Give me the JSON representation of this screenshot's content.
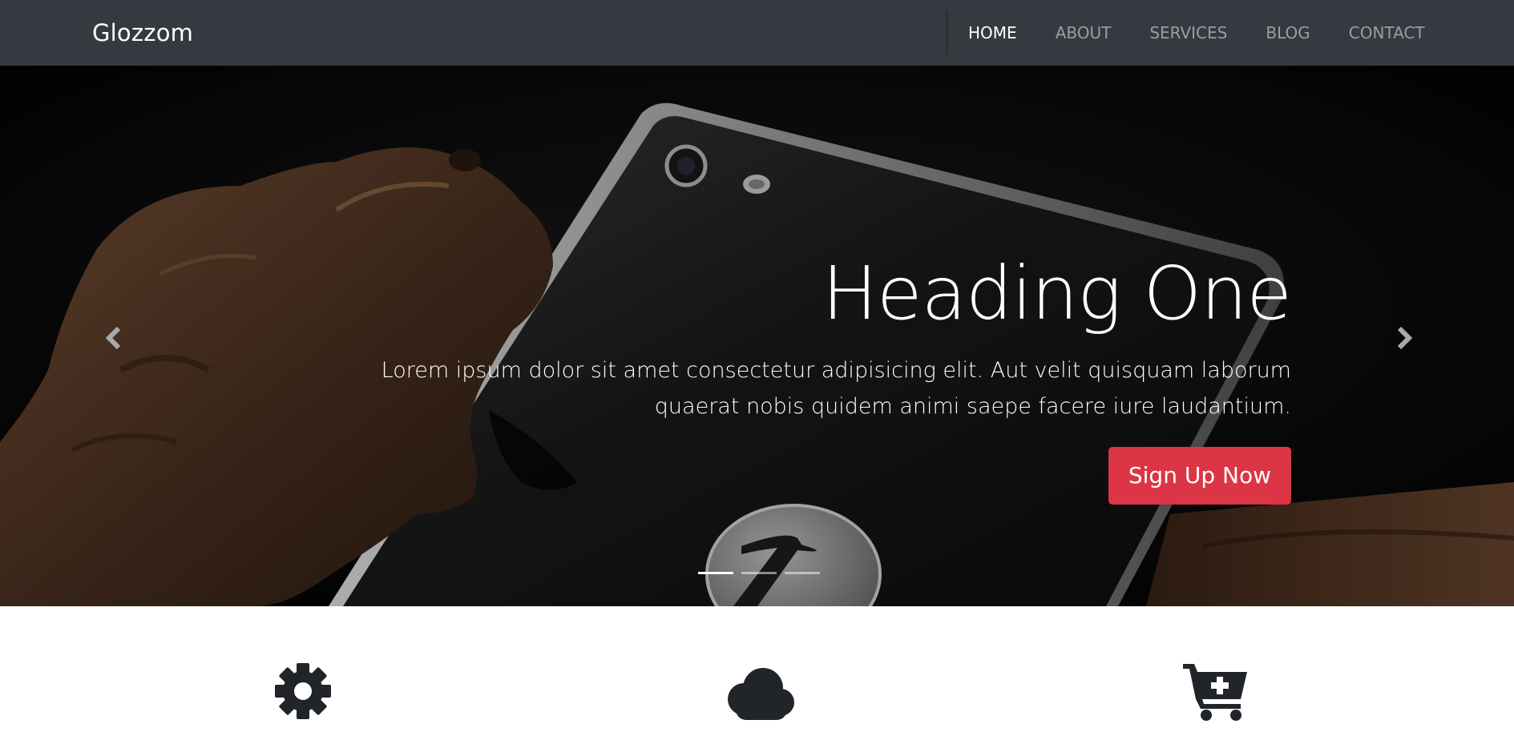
{
  "navbar": {
    "brand": "Glozzom",
    "links": [
      {
        "label": "HOME",
        "active": true
      },
      {
        "label": "ABOUT",
        "active": false
      },
      {
        "label": "SERVICES",
        "active": false
      },
      {
        "label": "BLOG",
        "active": false
      },
      {
        "label": "CONTACT",
        "active": false
      }
    ]
  },
  "hero": {
    "title": "Heading One",
    "text": "Lorem ipsum dolor sit amet consectetur adipisicing elit. Aut velit quisquam laborum quaerat nobis quidem animi saepe facere iure laudantium.",
    "button_label": "Sign Up Now",
    "indicators": [
      {
        "active": true
      },
      {
        "active": false
      },
      {
        "active": false
      }
    ],
    "prev_icon": "chevron-left-icon",
    "next_icon": "chevron-right-icon"
  },
  "features": {
    "icons": [
      "gear-icon",
      "cloud-icon",
      "cart-plus-icon"
    ]
  },
  "colors": {
    "navbar_bg": "#343a40",
    "accent_button": "#dc3545",
    "icon_dark": "#212529"
  }
}
